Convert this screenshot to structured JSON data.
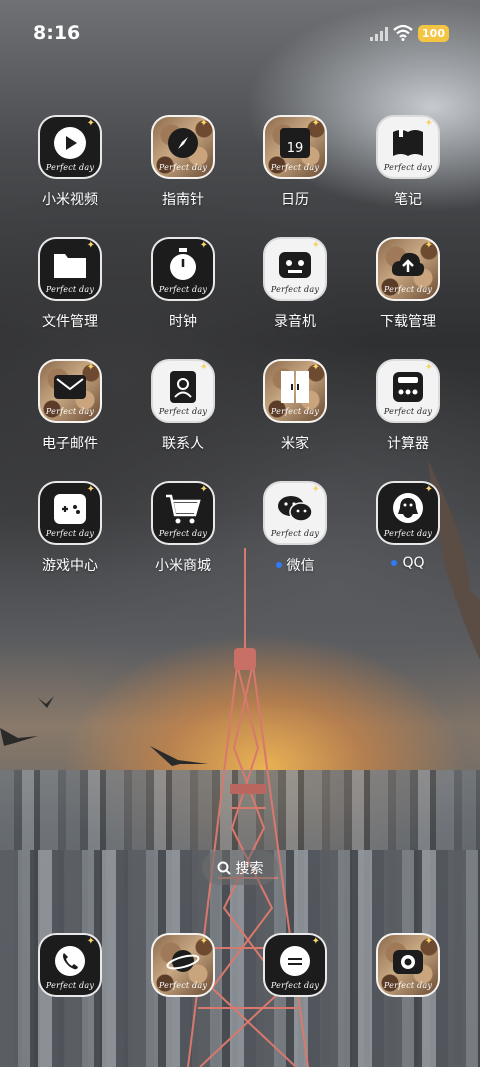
{
  "status_bar": {
    "time": "8:16",
    "battery": "100",
    "battery_color": "#f4c542"
  },
  "icon_caption": "Perfect day",
  "apps": [
    {
      "label": "小米视频",
      "icon": "play-icon",
      "style": "dark"
    },
    {
      "label": "指南针",
      "icon": "compass-icon",
      "style": "photo"
    },
    {
      "label": "日历",
      "icon": "calendar-icon",
      "style": "photo",
      "day": "19"
    },
    {
      "label": "笔记",
      "icon": "notebook-icon",
      "style": "light"
    },
    {
      "label": "文件管理",
      "icon": "folder-icon",
      "style": "dark"
    },
    {
      "label": "时钟",
      "icon": "stopwatch-icon",
      "style": "dark"
    },
    {
      "label": "录音机",
      "icon": "recorder-icon",
      "style": "light"
    },
    {
      "label": "下载管理",
      "icon": "download-icon",
      "style": "photo"
    },
    {
      "label": "电子邮件",
      "icon": "mail-icon",
      "style": "photo"
    },
    {
      "label": "联系人",
      "icon": "contacts-icon",
      "style": "light"
    },
    {
      "label": "米家",
      "icon": "door-icon",
      "style": "photo"
    },
    {
      "label": "计算器",
      "icon": "calculator-icon",
      "style": "light"
    },
    {
      "label": "游戏中心",
      "icon": "gamepad-icon",
      "style": "dark"
    },
    {
      "label": "小米商城",
      "icon": "cart-icon",
      "style": "dark"
    },
    {
      "label": "微信",
      "icon": "wechat-icon",
      "style": "light",
      "new_dot": true
    },
    {
      "label": "QQ",
      "icon": "qq-icon",
      "style": "dark",
      "new_dot": true
    }
  ],
  "search": {
    "label": "搜索",
    "icon": "search-icon"
  },
  "dock": [
    {
      "icon": "phone-icon",
      "style": "dark"
    },
    {
      "icon": "browser-planet-icon",
      "style": "photo"
    },
    {
      "icon": "message-icon",
      "style": "dark"
    },
    {
      "icon": "camera-icon",
      "style": "photo"
    }
  ],
  "new_dot_color": "#2f7bf5"
}
